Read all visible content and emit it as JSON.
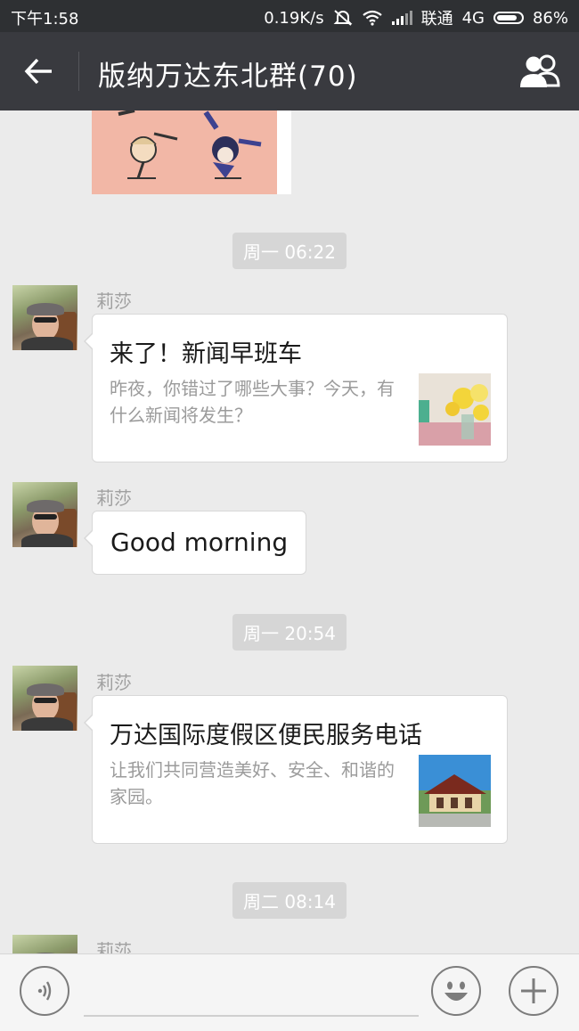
{
  "status_bar": {
    "time": "下午1:58",
    "speed": "0.19K/s",
    "carrier": "联通",
    "network": "4G",
    "battery": "86%",
    "battery_level": 0.86
  },
  "header": {
    "title": "版纳万达东北群(70)"
  },
  "messages": {
    "ts1": "周一 06:22",
    "ts2": "周一 20:54",
    "ts3": "周二 08:14",
    "m1": {
      "sender": "莉莎",
      "title": "来了！新闻早班车",
      "desc": "昨夜，你错过了哪些大事？今天，有什么新闻将发生？"
    },
    "m2": {
      "sender": "莉莎",
      "text": "Good morning"
    },
    "m3": {
      "sender": "莉莎",
      "title": "万达国际度假区便民服务电话",
      "desc": "让我们共同营造美好、安全、和谐的家园。"
    },
    "m4": {
      "sender": "莉莎"
    }
  },
  "colors": {
    "header_bg": "#393a3f",
    "statusbar_bg": "#2e3033",
    "chat_bg": "#ebebeb"
  }
}
